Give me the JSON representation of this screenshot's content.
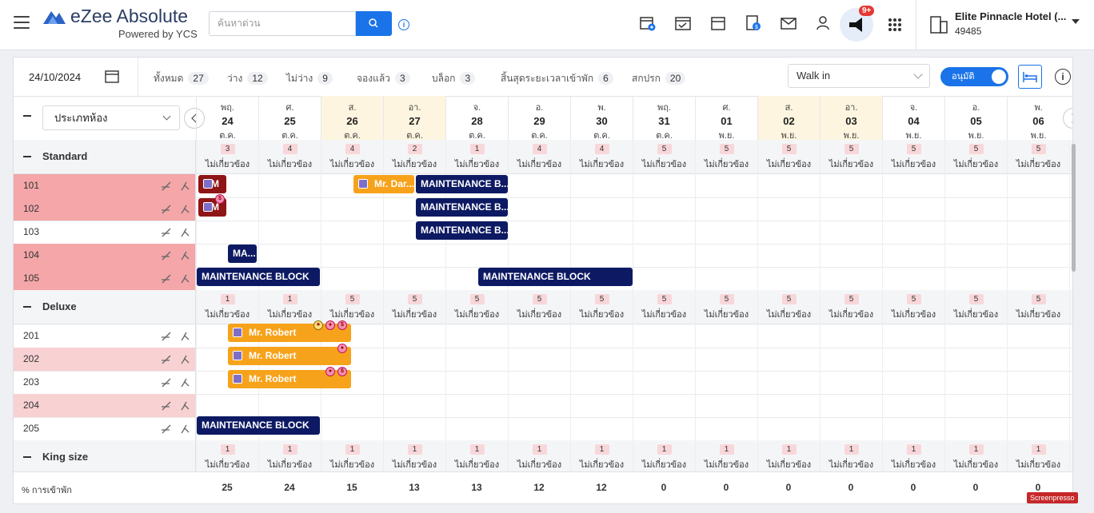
{
  "app": {
    "brand": "eZee Absolute",
    "brand_sub": "Powered by YCS",
    "search_placeholder": "ค้นหาด่วน",
    "notif_badge": "9+",
    "hotel_name": "Elite Pinnacle Hotel (...",
    "hotel_id": "49485"
  },
  "filters": {
    "date": "24/10/2024",
    "stats": [
      {
        "label": "ทั้งหมด",
        "value": "27"
      },
      {
        "label": "ว่าง",
        "value": "12"
      },
      {
        "label": "ไม่ว่าง",
        "value": "9"
      },
      {
        "label": "จองแล้ว",
        "value": "3"
      },
      {
        "label": "บล็อก",
        "value": "3"
      },
      {
        "label": "สิ้นสุดระยะเวลาเข้าพัก",
        "value": "6"
      },
      {
        "label": "สกปรก",
        "value": "20"
      }
    ],
    "walkin": "Walk in",
    "toggle_label": "อนุมัติ"
  },
  "grid": {
    "room_type_select": "ประเภทห้อง",
    "days": [
      {
        "dow": "พฤ.",
        "d": "24",
        "m": "ต.ค.",
        "weekend": false
      },
      {
        "dow": "ศ.",
        "d": "25",
        "m": "ต.ค.",
        "weekend": false
      },
      {
        "dow": "ส.",
        "d": "26",
        "m": "ต.ค.",
        "weekend": true
      },
      {
        "dow": "อา.",
        "d": "27",
        "m": "ต.ค.",
        "weekend": true
      },
      {
        "dow": "จ.",
        "d": "28",
        "m": "ต.ค.",
        "weekend": false
      },
      {
        "dow": "อ.",
        "d": "29",
        "m": "ต.ค.",
        "weekend": false
      },
      {
        "dow": "พ.",
        "d": "30",
        "m": "ต.ค.",
        "weekend": false
      },
      {
        "dow": "พฤ.",
        "d": "31",
        "m": "ต.ค.",
        "weekend": false
      },
      {
        "dow": "ศ.",
        "d": "01",
        "m": "พ.ย.",
        "weekend": false
      },
      {
        "dow": "ส.",
        "d": "02",
        "m": "พ.ย.",
        "weekend": true
      },
      {
        "dow": "อา.",
        "d": "03",
        "m": "พ.ย.",
        "weekend": true
      },
      {
        "dow": "จ.",
        "d": "04",
        "m": "พ.ย.",
        "weekend": false
      },
      {
        "dow": "อ.",
        "d": "05",
        "m": "พ.ย.",
        "weekend": false
      },
      {
        "dow": "พ.",
        "d": "06",
        "m": "พ.ย.",
        "weekend": false
      }
    ],
    "avail_label": "ไม่เกี่ยวข้อง",
    "groups": [
      {
        "name": "Standard",
        "counts": [
          "3",
          "4",
          "4",
          "2",
          "1",
          "4",
          "4",
          "5",
          "5",
          "5",
          "5",
          "5",
          "5",
          "5"
        ]
      },
      {
        "name": "Deluxe",
        "counts": [
          "1",
          "1",
          "5",
          "5",
          "5",
          "5",
          "5",
          "5",
          "5",
          "5",
          "5",
          "5",
          "5",
          "5"
        ]
      },
      {
        "name": "King size",
        "counts": [
          "1",
          "1",
          "1",
          "1",
          "1",
          "1",
          "1",
          "1",
          "1",
          "1",
          "1",
          "1",
          "1",
          "1"
        ]
      }
    ],
    "rooms": [
      {
        "num": "101",
        "status": "dirty"
      },
      {
        "num": "102",
        "status": "dirty"
      },
      {
        "num": "103",
        "status": "clean"
      },
      {
        "num": "104",
        "status": "dirty"
      },
      {
        "num": "105",
        "status": "dirty"
      },
      {
        "num": "201",
        "status": "clean"
      },
      {
        "num": "202",
        "status": "light"
      },
      {
        "num": "203",
        "status": "clean"
      },
      {
        "num": "204",
        "status": "light"
      },
      {
        "num": "205",
        "status": "clean"
      }
    ],
    "bars": {
      "b101a": "M",
      "b101b": "Mr. Dar...",
      "b101c": "MAINTENANCE B...",
      "b102a": "M",
      "b102c": "MAINTENANCE B...",
      "b103c": "MAINTENANCE B...",
      "b104": "MA...",
      "b105a": "MAINTENANCE BLOCK",
      "b105b": "MAINTENANCE BLOCK",
      "b201": "Mr. Robert",
      "b202": "Mr. Robert",
      "b203": "Mr. Robert",
      "b205": "MAINTENANCE BLOCK"
    },
    "occupancy_label": "% การเข้าพัก",
    "occupancy": [
      "25",
      "24",
      "15",
      "13",
      "13",
      "12",
      "12",
      "0",
      "0",
      "0",
      "0",
      "0",
      "0",
      "0"
    ]
  },
  "watermark": "Screenpresso"
}
